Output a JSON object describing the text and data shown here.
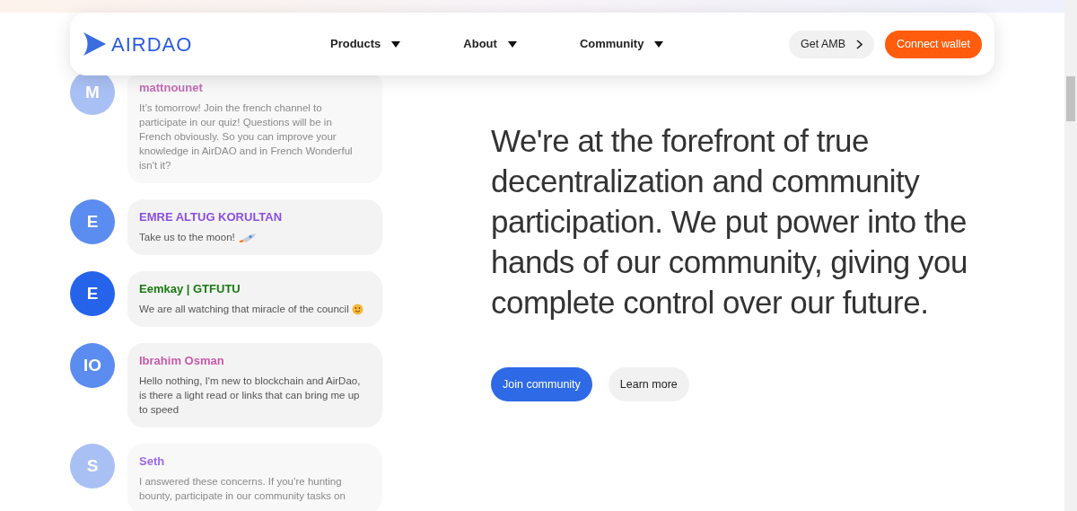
{
  "header": {
    "logo": "AIRDAO",
    "nav": [
      {
        "label": "Products"
      },
      {
        "label": "About"
      },
      {
        "label": "Community"
      }
    ],
    "get_amb": "Get AMB",
    "connect": "Connect wallet"
  },
  "messages": [
    {
      "initials": "M",
      "name": "mattnounet",
      "color": "#c56db5",
      "text": "It’s tomorrow! Join the french channel to participate in our quiz! Questions will be in French obviously. So you can improve your knowledge in AirDAO and in French Wonderful isn't it?",
      "faded": true,
      "kind": "plain"
    },
    {
      "initials": "E",
      "name": "EMRE ALTUG KORULTAN",
      "color": "#8b4fe0",
      "text": "Take us to the moon!",
      "faded": false,
      "kind": "rocket"
    },
    {
      "initials": "E",
      "name": "Eemkay | GTFUTU",
      "color": "#1a7a10",
      "text": "We are all watching that miracle of the council",
      "faded": false,
      "kind": "smiley"
    },
    {
      "initials": "IO",
      "name": "Ibrahim Osman",
      "color": "#c95aa8",
      "text": "Hello nothing, I'm new to blockchain and AirDao, is there a light read or links that can bring me up to speed",
      "faded": false,
      "kind": "plain"
    },
    {
      "initials": "S",
      "name": "Seth",
      "color": "#9a6be6",
      "text": "I answered these concerns. If you’re hunting bounty, participate in our community tasks on",
      "faded": true,
      "kind": "plain"
    }
  ],
  "hero": {
    "text": "We're at the forefront of true decentralization and community participation. We put power into the hands of our community, giving you complete control over our future.",
    "primary": "Join community",
    "secondary": "Learn more"
  }
}
